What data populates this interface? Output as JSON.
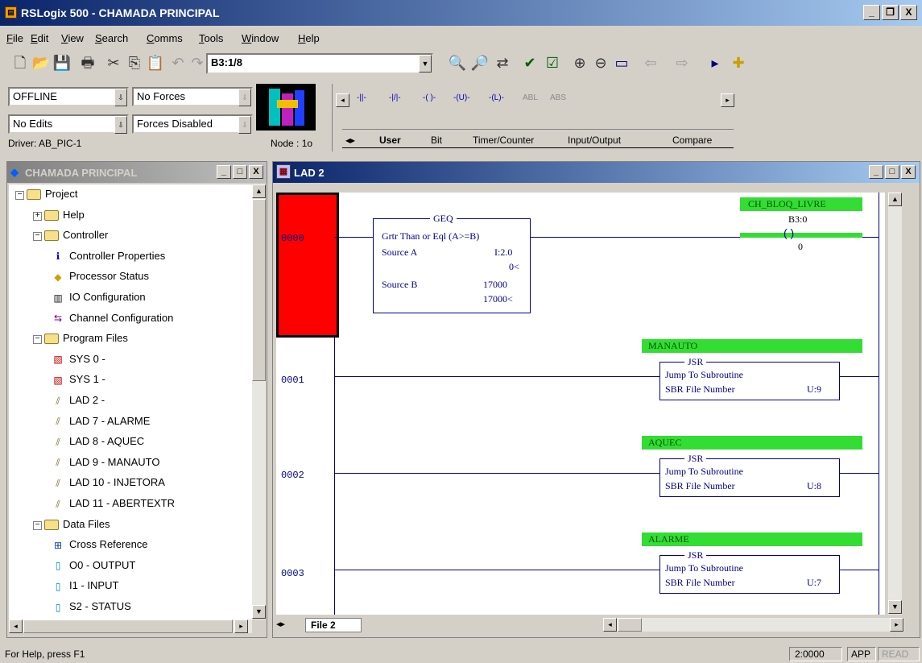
{
  "app": {
    "title": "RSLogix 500 - CHAMADA PRINCIPAL"
  },
  "title_buttons": [
    "_",
    "̅",
    "X"
  ],
  "menu": [
    "File",
    "Edit",
    "View",
    "Search",
    "Comms",
    "Tools",
    "Window",
    "Help"
  ],
  "toolbar": {
    "address": "B3:1/8"
  },
  "status_panel": {
    "mode": "OFFLINE",
    "forces": "No Forces",
    "edits": "No Edits",
    "forces_state": "Forces Disabled",
    "driver": "Driver: AB_PIC-1",
    "node": "Node : 1o"
  },
  "instruction_palette": {
    "symbols": [
      "-||-",
      "-|/|-",
      "-( )-",
      "-(U)-",
      "-(L)-",
      "ABL",
      "ABS"
    ],
    "tabs": [
      "User",
      "Bit",
      "Timer/Counter",
      "Input/Output",
      "Compare"
    ]
  },
  "project_window": {
    "title": "CHAMADA PRINCIPAL",
    "tree": [
      {
        "label": "Project",
        "level": 0,
        "kind": "folder"
      },
      {
        "label": "Help",
        "level": 1,
        "kind": "folder"
      },
      {
        "label": "Controller",
        "level": 1,
        "kind": "folder"
      },
      {
        "label": "Controller Properties",
        "level": 2,
        "kind": "info"
      },
      {
        "label": "Processor Status",
        "level": 2,
        "kind": "status"
      },
      {
        "label": "IO Configuration",
        "level": 2,
        "kind": "io"
      },
      {
        "label": "Channel Configuration",
        "level": 2,
        "kind": "channel"
      },
      {
        "label": "Program Files",
        "level": 1,
        "kind": "folder"
      },
      {
        "label": "SYS 0 -",
        "level": 2,
        "kind": "sys"
      },
      {
        "label": "SYS 1 -",
        "level": 2,
        "kind": "sys"
      },
      {
        "label": "LAD 2 -",
        "level": 2,
        "kind": "lad"
      },
      {
        "label": "LAD 7 - ALARME",
        "level": 2,
        "kind": "lad"
      },
      {
        "label": "LAD 8 - AQUEC",
        "level": 2,
        "kind": "lad"
      },
      {
        "label": "LAD 9 - MANAUTO",
        "level": 2,
        "kind": "lad"
      },
      {
        "label": "LAD 10 - INJETORA",
        "level": 2,
        "kind": "lad"
      },
      {
        "label": "LAD 11 - ABERTEXTR",
        "level": 2,
        "kind": "lad"
      },
      {
        "label": "Data Files",
        "level": 1,
        "kind": "folder"
      },
      {
        "label": "Cross Reference",
        "level": 2,
        "kind": "xref"
      },
      {
        "label": "O0 - OUTPUT",
        "level": 2,
        "kind": "file"
      },
      {
        "label": "I1 - INPUT",
        "level": 2,
        "kind": "file"
      },
      {
        "label": "S2 - STATUS",
        "level": 2,
        "kind": "file"
      }
    ]
  },
  "ladder_window": {
    "title": "LAD 2",
    "file_tab": "File 2",
    "rungs": [
      {
        "number": "0000",
        "instruction": {
          "mnemonic": "GEQ",
          "desc": "Grtr Than or Eql (A>=B)",
          "src_a_label": "Source A",
          "src_a": "I:2.0",
          "src_a_val": "0<",
          "src_b_label": "Source B",
          "src_b": "17000",
          "src_b_val": "17000<"
        },
        "coil": {
          "tag": "CH_BLOQ_LIVRE",
          "address": "B3:0",
          "bit": "0"
        }
      },
      {
        "number": "0001",
        "tag": "MANAUTO",
        "mnemonic": "JSR",
        "desc": "Jump To Subroutine",
        "param": "SBR File Number",
        "value": "U:9"
      },
      {
        "number": "0002",
        "tag": "AQUEC",
        "mnemonic": "JSR",
        "desc": "Jump To Subroutine",
        "param": "SBR File Number",
        "value": "U:8"
      },
      {
        "number": "0003",
        "tag": "ALARME",
        "mnemonic": "JSR",
        "desc": "Jump To Subroutine",
        "param": "SBR File Number",
        "value": "U:7"
      }
    ]
  },
  "statusbar": {
    "help": "For Help, press F1",
    "pos": "2:0000",
    "app": "APP",
    "read": "READ"
  }
}
